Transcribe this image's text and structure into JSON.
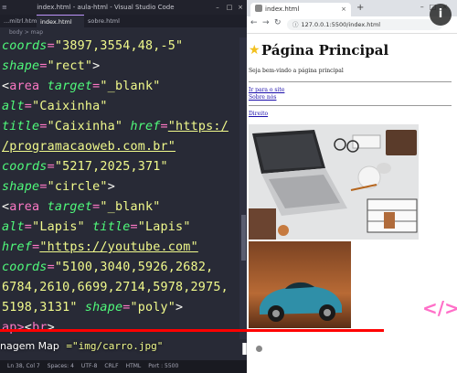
{
  "vscode": {
    "window_title": "index.html - aula-html - Visual Studio Code",
    "tabs": [
      {
        "label": "...mitrl.html",
        "active": false
      },
      {
        "label": "index.html",
        "active": true
      },
      {
        "label": "sobre.html",
        "active": false
      }
    ],
    "breadcrumb": "body > map",
    "code_lines": [
      [
        {
          "t": "coords",
          "c": "attr"
        },
        {
          "t": "=",
          "c": "eq"
        },
        {
          "t": "\"3897,3554,48,-5\"",
          "c": "str"
        }
      ],
      [
        {
          "t": "shape",
          "c": "attr"
        },
        {
          "t": "=",
          "c": "eq"
        },
        {
          "t": "\"rect\"",
          "c": "str"
        },
        {
          "t": ">",
          "c": "punc"
        }
      ],
      [
        {
          "t": "<",
          "c": "punc"
        },
        {
          "t": "area ",
          "c": "tag"
        },
        {
          "t": "target",
          "c": "attr"
        },
        {
          "t": "=",
          "c": "eq"
        },
        {
          "t": "\"_blank\"",
          "c": "str"
        }
      ],
      [
        {
          "t": "alt",
          "c": "attr"
        },
        {
          "t": "=",
          "c": "eq"
        },
        {
          "t": "\"Caixinha\"",
          "c": "str"
        }
      ],
      [
        {
          "t": "title",
          "c": "attr"
        },
        {
          "t": "=",
          "c": "eq"
        },
        {
          "t": "\"Caixinha\" ",
          "c": "str"
        },
        {
          "t": "href",
          "c": "attr"
        },
        {
          "t": "=",
          "c": "eq"
        },
        {
          "t": "\"https:/",
          "c": "str",
          "link": true
        }
      ],
      [
        {
          "t": "/programacaoweb.com.br\"",
          "c": "str",
          "link": true
        }
      ],
      [
        {
          "t": "coords",
          "c": "attr"
        },
        {
          "t": "=",
          "c": "eq"
        },
        {
          "t": "\"5217,2025,371\"",
          "c": "str"
        }
      ],
      [
        {
          "t": "shape",
          "c": "attr"
        },
        {
          "t": "=",
          "c": "eq"
        },
        {
          "t": "\"circle\"",
          "c": "str"
        },
        {
          "t": ">",
          "c": "punc"
        }
      ],
      [
        {
          "t": "<",
          "c": "punc"
        },
        {
          "t": "area ",
          "c": "tag"
        },
        {
          "t": "target",
          "c": "attr"
        },
        {
          "t": "=",
          "c": "eq"
        },
        {
          "t": "\"_blank\"",
          "c": "str"
        }
      ],
      [
        {
          "t": "alt",
          "c": "attr"
        },
        {
          "t": "=",
          "c": "eq"
        },
        {
          "t": "\"Lapis\" ",
          "c": "str"
        },
        {
          "t": "title",
          "c": "attr"
        },
        {
          "t": "=",
          "c": "eq"
        },
        {
          "t": "\"Lapis\"",
          "c": "str"
        }
      ],
      [
        {
          "t": "href",
          "c": "attr"
        },
        {
          "t": "=",
          "c": "eq"
        },
        {
          "t": "\"https://youtube.com\"",
          "c": "str",
          "link": true
        }
      ],
      [
        {
          "t": "coords",
          "c": "attr"
        },
        {
          "t": "=",
          "c": "eq"
        },
        {
          "t": "\"5100,3040,5926,2682,",
          "c": "str"
        }
      ],
      [
        {
          "t": "6784,2610,6699,2714,5978,2975,",
          "c": "str"
        }
      ],
      [
        {
          "t": "5198,3131\" ",
          "c": "str"
        },
        {
          "t": "shape",
          "c": "attr"
        },
        {
          "t": "=",
          "c": "eq"
        },
        {
          "t": "\"poly\"",
          "c": "str"
        },
        {
          "t": ">",
          "c": "punc"
        }
      ],
      [
        {
          "t": "ap>",
          "c": "tag"
        },
        {
          "t": "<",
          "c": "punc"
        },
        {
          "t": "br",
          "c": "tag"
        },
        {
          "t": ">",
          "c": "punc"
        }
      ]
    ],
    "status_items": [
      "Ln 38, Col 7",
      "Spaces: 4",
      "UTF-8",
      "CRLF",
      "HTML",
      "Port : 5500"
    ]
  },
  "browser": {
    "tab_title": "index.html",
    "url": "127.0.0.1:5500/index.html",
    "page": {
      "title": "Página Principal",
      "welcome": "Seja bem-vindo a página principal",
      "links": [
        "Ir para o site",
        "Sobre nós",
        "Direito"
      ]
    }
  },
  "video": {
    "chapter_title": "nagem Map",
    "chapter_code": "=\"img/carro.jpg\"",
    "played_fraction": 0.84,
    "buffered_fraction": 0.9
  },
  "colors": {
    "vscode_bg": "#282a36",
    "attr": "#50fa7b",
    "string": "#f1fa8c",
    "keyword": "#ff79c6",
    "progress_red": "#ff0000",
    "star": "#f2c01e"
  }
}
